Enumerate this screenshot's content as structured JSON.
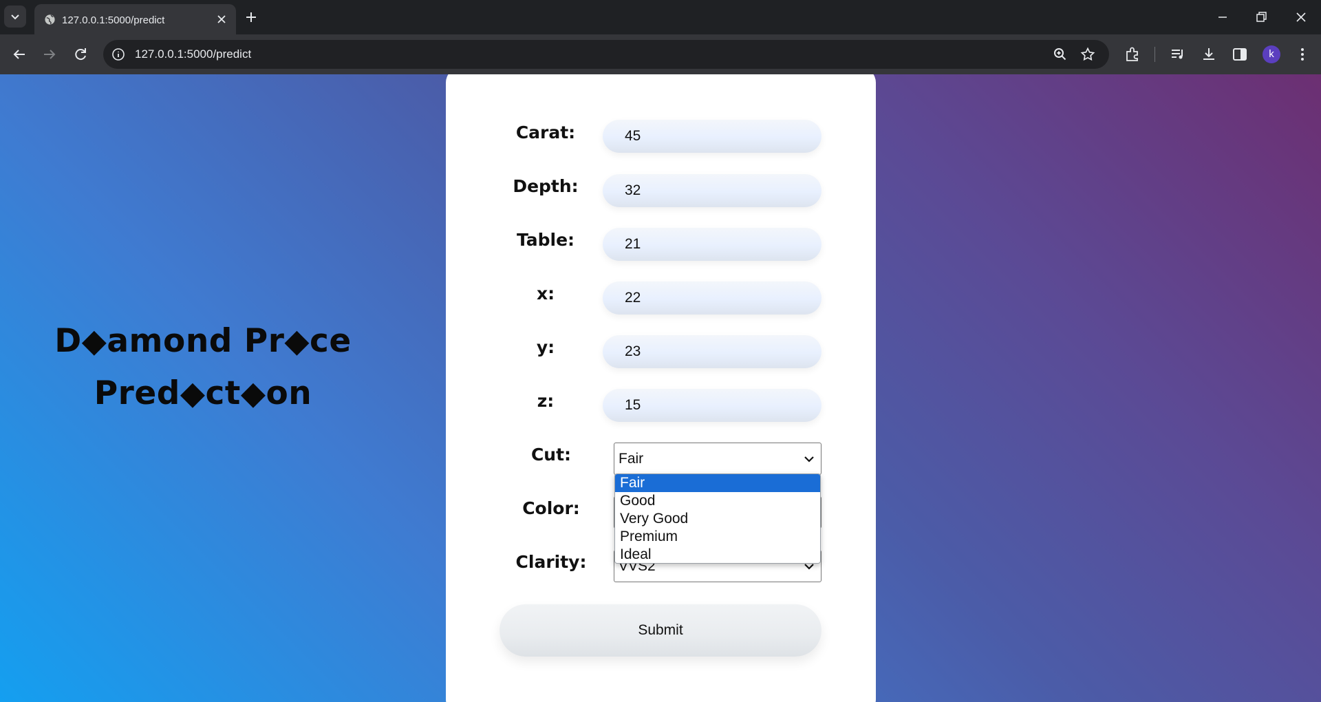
{
  "browser": {
    "tab_title": "127.0.0.1:5000/predict",
    "url": "127.0.0.1:5000/predict",
    "profile_initial": "k"
  },
  "page": {
    "heading_line1": "D◆amond Pr◆ce",
    "heading_line2": "Pred◆ct◆on",
    "fields": {
      "carat": {
        "label": "Carat:",
        "value": "45"
      },
      "depth": {
        "label": "Depth:",
        "value": "32"
      },
      "table": {
        "label": "Table:",
        "value": "21"
      },
      "x": {
        "label": "x:",
        "value": "22"
      },
      "y": {
        "label": "y:",
        "value": "23"
      },
      "z": {
        "label": "z:",
        "value": "15"
      }
    },
    "cut": {
      "label": "Cut:",
      "value": "Fair"
    },
    "color": {
      "label": "Color:"
    },
    "clarity": {
      "label": "Clarity:",
      "value": "VVS2"
    },
    "cut_options": [
      "Fair",
      "Good",
      "Very Good",
      "Premium",
      "Ideal"
    ],
    "submit_label": "Submit"
  },
  "colors": {
    "highlight": "#1a6dd6",
    "gradient_start": "#149ff0",
    "gradient_end": "#6c2f72"
  }
}
